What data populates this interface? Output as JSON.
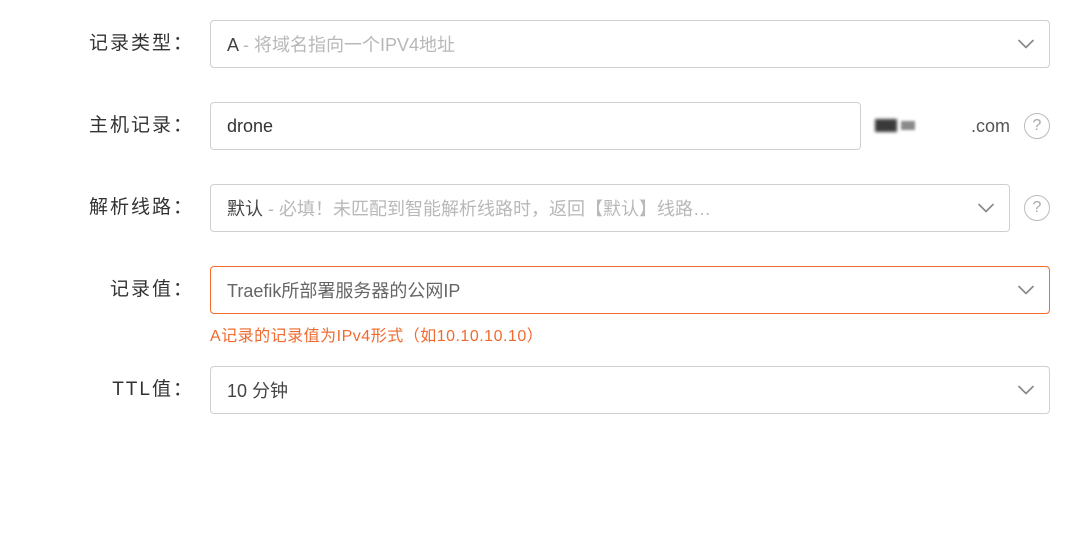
{
  "labels": {
    "recordType": "记录类型",
    "host": "主机记录",
    "line": "解析线路",
    "value": "记录值",
    "ttl": "TTL值"
  },
  "recordType": {
    "value": "A",
    "hint": " - 将域名指向一个IPV4地址"
  },
  "host": {
    "value": "drone",
    "domainSuffix": ".com"
  },
  "line": {
    "value": "默认",
    "hint": " - 必填！未匹配到智能解析线路时，返回【默认】线路…"
  },
  "recordValue": {
    "value": "Traefik所部署服务器的公网IP",
    "error": "A记录的记录值为IPv4形式（如10.10.10.10）"
  },
  "ttl": {
    "value": "10 分钟"
  },
  "glyph": {
    "help": "?"
  }
}
